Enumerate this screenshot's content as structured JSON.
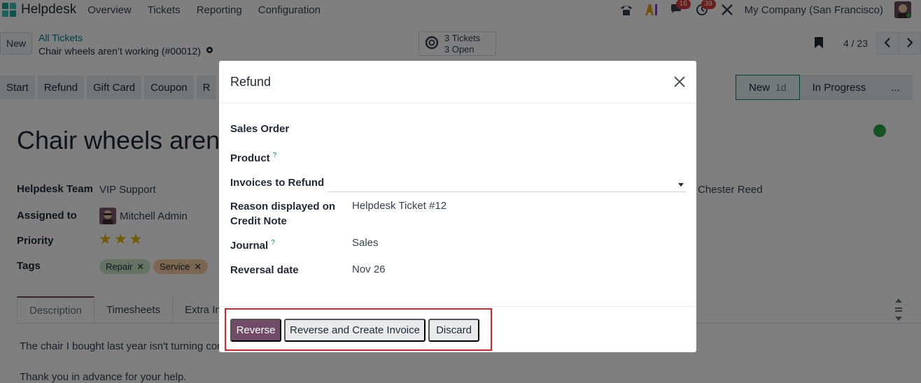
{
  "navbar": {
    "app_name": "Helpdesk",
    "menu": [
      "Overview",
      "Tickets",
      "Reporting",
      "Configuration"
    ],
    "chat_count": "16",
    "activity_count": "39",
    "company": "My Company (San Francisco)"
  },
  "control": {
    "new_label": "New",
    "breadcrumb_parent": "All Tickets",
    "breadcrumb_current": "Chair wheels aren’t working (#00012)",
    "tickets_line1": "3 Tickets",
    "tickets_line2": "3 Open",
    "pager": "4 / 23"
  },
  "actions": [
    "Start",
    "Refund",
    "Gift Card",
    "Coupon",
    "R"
  ],
  "stages": {
    "current": "New",
    "current_duration": "1d",
    "next": "In Progress",
    "more": "..."
  },
  "form": {
    "title": "Chair wheels aren’t",
    "team_label": "Helpdesk Team",
    "team_value": "VIP Support",
    "assigned_label": "Assigned to",
    "assigned_value": "Mitchell Admin",
    "priority_label": "Priority",
    "priority_stars": 3,
    "tags_label": "Tags",
    "tags": [
      "Repair",
      "Service"
    ],
    "customer": "Chester Reed",
    "tabs": [
      "Description",
      "Timesheets",
      "Extra Info"
    ],
    "description_line1": "The chair I bought last year isn't turning cor",
    "description_line2": "Thank you in advance for your help."
  },
  "modal": {
    "title": "Refund",
    "sales_order_label": "Sales Order",
    "product_label": "Product",
    "invoices_label": "Invoices to Refund",
    "reason_label_1": "Reason displayed on",
    "reason_label_2": "Credit Note",
    "reason_value": "Helpdesk Ticket #12",
    "journal_label": "Journal",
    "journal_value": "Sales",
    "reversal_label": "Reversal date",
    "reversal_value": "Nov 26",
    "help_mark": "?",
    "btn_reverse": "Reverse",
    "btn_reverse_invoice": "Reverse and Create Invoice",
    "btn_discard": "Discard"
  },
  "colors": {
    "primary": "#714b67",
    "link": "#017e84",
    "highlight": "#d7262d"
  }
}
